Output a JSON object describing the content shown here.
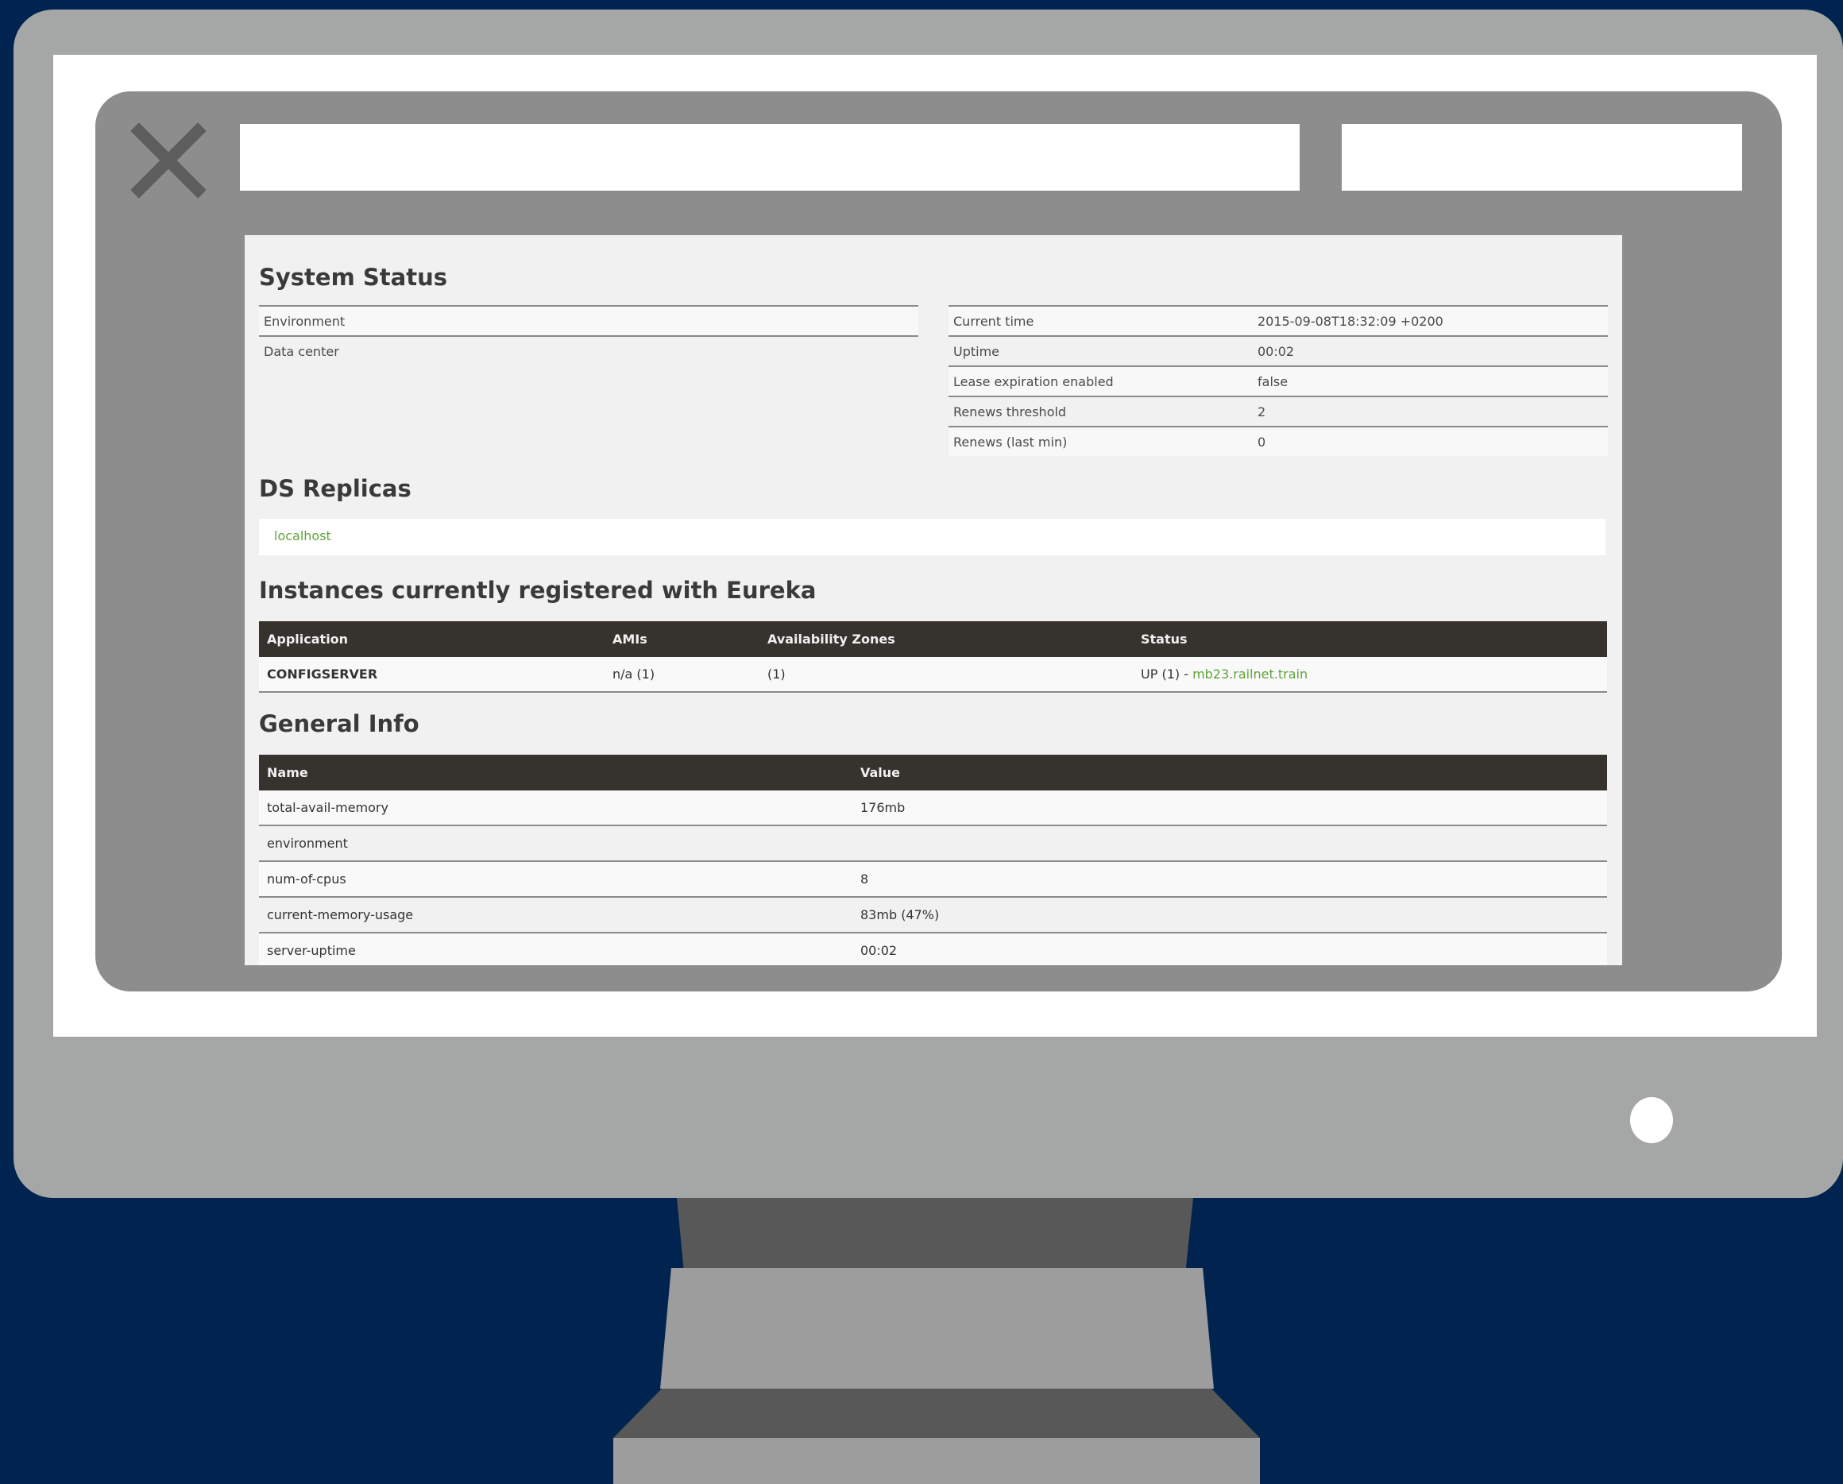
{
  "system_status": {
    "title": "System Status",
    "left": [
      {
        "key": "Environment",
        "value": ""
      },
      {
        "key": "Data center",
        "value": ""
      }
    ],
    "right": [
      {
        "key": "Current time",
        "value": "2015-09-08T18:32:09 +0200"
      },
      {
        "key": "Uptime",
        "value": "00:02"
      },
      {
        "key": "Lease expiration enabled",
        "value": "false"
      },
      {
        "key": "Renews threshold",
        "value": "2"
      },
      {
        "key": "Renews (last min)",
        "value": "0"
      }
    ]
  },
  "ds_replicas": {
    "title": "DS Replicas",
    "items": [
      "localhost"
    ]
  },
  "instances": {
    "title": "Instances currently registered with Eureka",
    "headers": [
      "Application",
      "AMIs",
      "Availability Zones",
      "Status"
    ],
    "rows": [
      {
        "application": "CONFIGSERVER",
        "amis": "n/a (1)",
        "zones": "(1)",
        "status_prefix": "UP (1) - ",
        "status_link": "mb23.railnet.train"
      }
    ]
  },
  "general_info": {
    "title": "General Info",
    "headers": [
      "Name",
      "Value"
    ],
    "rows": [
      {
        "name": "total-avail-memory",
        "value": "176mb"
      },
      {
        "name": "environment",
        "value": ""
      },
      {
        "name": "num-of-cpus",
        "value": "8"
      },
      {
        "name": "current-memory-usage",
        "value": "83mb (47%)"
      },
      {
        "name": "server-uptime",
        "value": "00:02"
      }
    ]
  },
  "colors": {
    "background": "#002350",
    "monitor": "#a4a7a6",
    "window": "#8d8d8d",
    "link": "#5fa33c",
    "table_header": "#36322e"
  }
}
